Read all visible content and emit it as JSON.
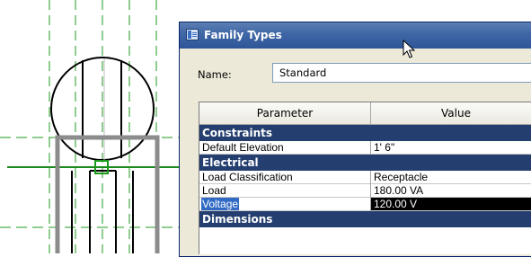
{
  "dialog": {
    "title": "Family Types",
    "title_icon": "family-types-icon",
    "name_label": "Name:",
    "name_value": "Standard"
  },
  "grid": {
    "headers": {
      "parameter": "Parameter",
      "value": "Value"
    },
    "groups": [
      {
        "label": "Constraints",
        "rows": [
          {
            "parameter": "Default Elevation",
            "value": "1'  6\""
          }
        ]
      },
      {
        "label": "Electrical",
        "rows": [
          {
            "parameter": "Load Classification",
            "value": "Receptacle"
          },
          {
            "parameter": "Load",
            "value": "180.00 VA"
          },
          {
            "parameter": "Voltage",
            "value": "120.00 V",
            "selected": true
          }
        ]
      },
      {
        "label": "Dimensions",
        "rows": []
      }
    ]
  },
  "colors": {
    "title_bar": "#3f66a5",
    "group_header": "#243f6f",
    "selection": "#316ac5",
    "reference_line": "#1a8a1a",
    "symbol_gray": "#8c8c8c"
  }
}
